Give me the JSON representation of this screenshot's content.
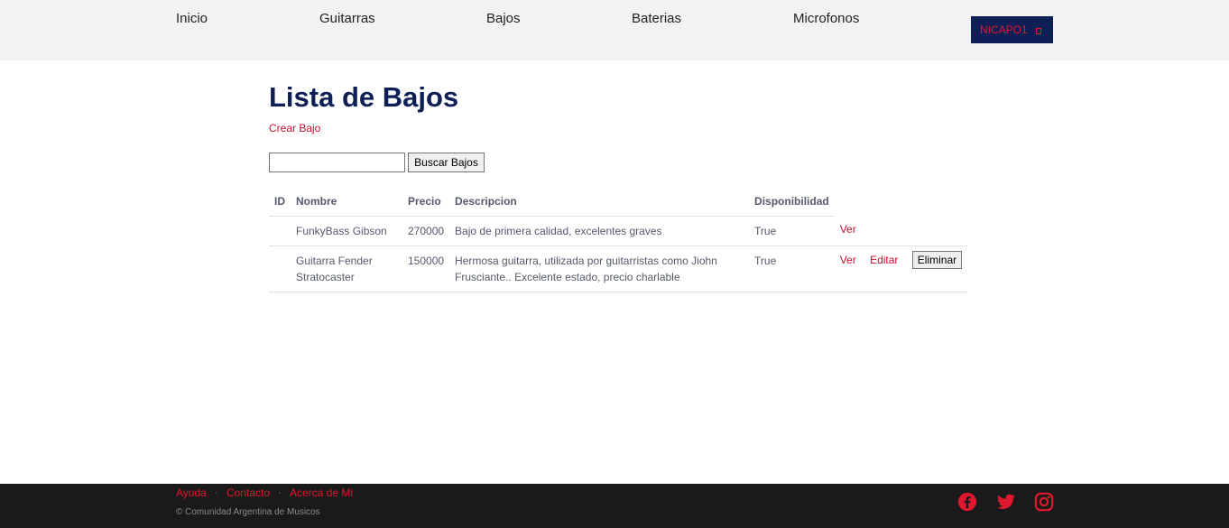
{
  "nav": {
    "items": [
      "Inicio",
      "Guitarras",
      "Bajos",
      "Baterias",
      "Microfonos"
    ],
    "user": "NICAPO1"
  },
  "main": {
    "title": "Lista de Bajos",
    "create_link": "Crear Bajo",
    "search": {
      "value": "",
      "placeholder": "",
      "button": "Buscar Bajos"
    },
    "table": {
      "headers": [
        "ID",
        "Nombre",
        "Precio",
        "Descripcion",
        "Disponibilidad"
      ],
      "rows": [
        {
          "id": "",
          "nombre": "FunkyBass Gibson",
          "precio": "270000",
          "descripcion": "Bajo de primera calidad, excelentes graves",
          "disponibilidad": "True",
          "actions": {
            "ver": "Ver"
          }
        },
        {
          "id": "",
          "nombre": "Guitarra Fender Stratocaster",
          "precio": "150000",
          "descripcion": "Hermosa guitarra, utilizada por guitarristas como Jiohn Frusciante.. Excelente estado, precio charlable",
          "disponibilidad": "True",
          "actions": {
            "ver": "Ver",
            "editar": "Editar",
            "eliminar": "Eliminar"
          }
        }
      ]
    }
  },
  "footer": {
    "links": [
      "Ayuda",
      "Contacto",
      "Acerca de Mi"
    ],
    "separator": "·",
    "copyright": "© Comunidad Argentina de Musicos",
    "social_icons": [
      "facebook-icon",
      "twitter-icon",
      "instagram-icon"
    ],
    "social_color": "#e0182d"
  },
  "colors": {
    "brand_navy": "#0e1f56",
    "accent_red": "#c8102e",
    "footer_bg": "#1a1a1a",
    "header_bg": "#f2f2f2"
  }
}
